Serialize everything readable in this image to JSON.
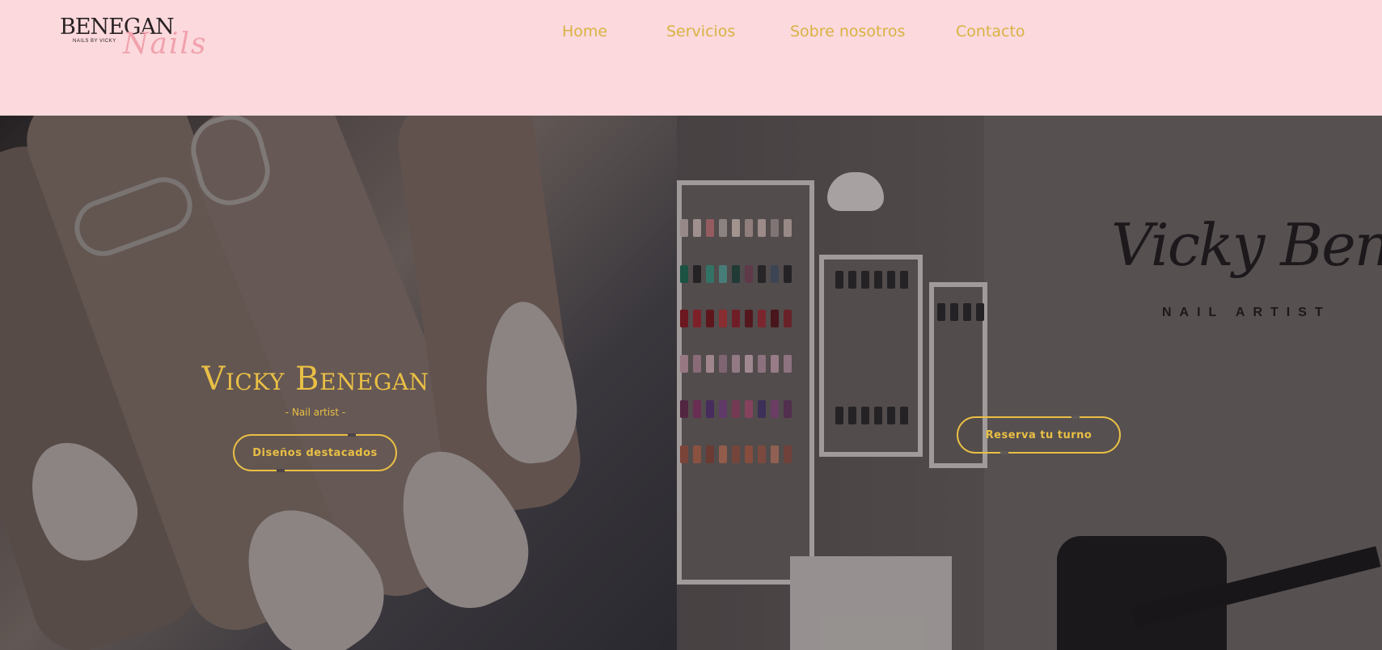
{
  "header": {
    "logo": {
      "main": "BENEGAN",
      "sub": "NAILS BY VICKY",
      "script": "Nails"
    },
    "nav": [
      {
        "label": "Home"
      },
      {
        "label": "Servicios"
      },
      {
        "label": "Sobre nosotros"
      },
      {
        "label": "Contacto"
      }
    ]
  },
  "hero": {
    "left": {
      "title": "Vicky Benegan",
      "subtitle": "- Nail artist -",
      "button": "Diseños destacados"
    },
    "right": {
      "sign_main": "Vicky Benegan",
      "sign_sub": "NAIL ARTIST",
      "button": "Reserva tu turno"
    }
  },
  "colors": {
    "header_bg": "#fbd9dd",
    "accent_gold": "#e9bf45",
    "nav_text": "#d9b342",
    "logo_script": "#f1a2ad"
  }
}
